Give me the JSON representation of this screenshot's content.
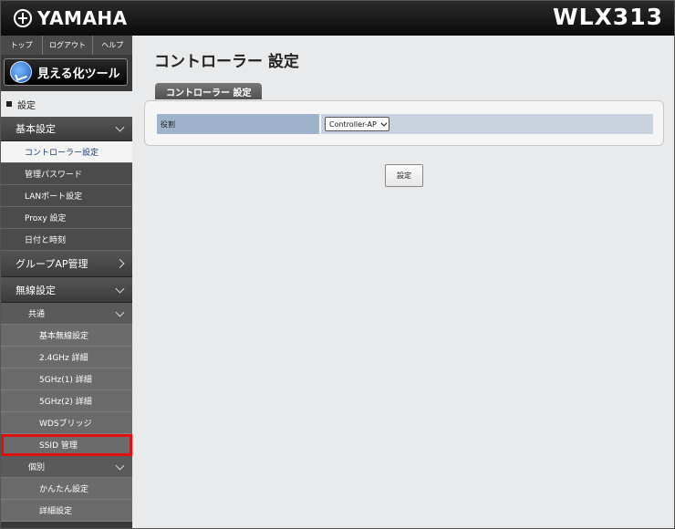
{
  "header": {
    "brand": "YAMAHA",
    "model": "WLX313"
  },
  "sidebar": {
    "top_links": [
      "トップ",
      "ログアウト",
      "ヘルプ"
    ],
    "visualize_button": "見える化ツール",
    "settings_heading": "設定",
    "basic_group": "基本設定",
    "basic_items": [
      "コントローラー設定",
      "管理パスワード",
      "LANポート設定",
      "Proxy 設定",
      "日付と時刻"
    ],
    "group_ap": "グループAP管理",
    "wireless_group": "無線設定",
    "common": "共通",
    "common_items": [
      "基本無線設定",
      "2.4GHz 詳細",
      "5GHz(1) 詳細",
      "5GHz(2) 詳細",
      "WDSブリッジ",
      "SSID 管理"
    ],
    "individual": "個別",
    "individual_items": [
      "かんたん設定",
      "詳細設定"
    ]
  },
  "main": {
    "title": "コントローラー 設定",
    "tab": "コントローラー 設定",
    "role_label": "役割",
    "role_value": "Controller-AP",
    "submit": "設定"
  },
  "colors": {
    "highlight": "#e01010",
    "active_text": "#1a3c78"
  }
}
